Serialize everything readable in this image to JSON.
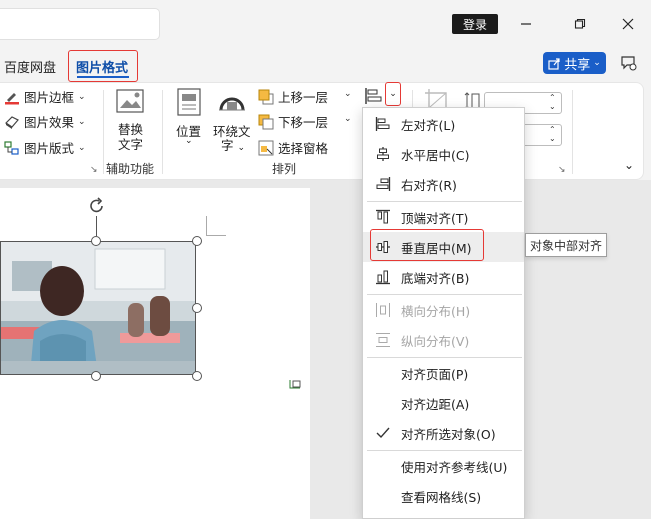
{
  "titlebar": {
    "login_label": "登录",
    "min_icon": "minimize-icon",
    "restore_icon": "restore-icon",
    "close_icon": "close-icon"
  },
  "tabs": [
    {
      "label": "百度网盘"
    },
    {
      "label": "图片格式",
      "active": true
    }
  ],
  "share": {
    "label": "共享"
  },
  "ribbon": {
    "picture_styles": [
      {
        "label": "图片边框",
        "icon": "picture-border-icon"
      },
      {
        "label": "图片效果",
        "icon": "picture-effects-icon"
      },
      {
        "label": "图片版式",
        "icon": "picture-layout-icon"
      }
    ],
    "accessibility": {
      "button_label_1": "替换",
      "button_label_2": "文字",
      "group_label": "辅助功能"
    },
    "arrange": {
      "position_label": "位置",
      "wrap_label_1": "环绕文",
      "wrap_label_2": "字",
      "bring_forward_label": "上移一层",
      "send_backward_label": "下移一层",
      "selection_pane_label": "选择窗格",
      "group_label": "排列"
    }
  },
  "align_menu": {
    "items": [
      {
        "label": "左对齐(L)",
        "icon": "align-left-icon",
        "disabled": false
      },
      {
        "label": "水平居中(C)",
        "icon": "align-center-icon",
        "disabled": false
      },
      {
        "label": "右对齐(R)",
        "icon": "align-right-icon",
        "disabled": false
      },
      {
        "label": "顶端对齐(T)",
        "icon": "align-top-icon",
        "disabled": false
      },
      {
        "label": "垂直居中(M)",
        "icon": "align-middle-icon",
        "disabled": false,
        "highlighted": true
      },
      {
        "label": "底端对齐(B)",
        "icon": "align-bottom-icon",
        "disabled": false
      },
      {
        "label": "横向分布(H)",
        "icon": "distribute-horizontal-icon",
        "disabled": true
      },
      {
        "label": "纵向分布(V)",
        "icon": "distribute-vertical-icon",
        "disabled": true
      },
      {
        "label": "对齐页面(P)",
        "disabled": false
      },
      {
        "label": "对齐边距(A)",
        "disabled": false
      },
      {
        "label": "对齐所选对象(O)",
        "checked": true,
        "disabled": false
      },
      {
        "label": "使用对齐参考线(U)",
        "disabled": false
      },
      {
        "label": "查看网格线(S)",
        "disabled": false
      }
    ],
    "tooltip": "对象中部对齐"
  },
  "colors": {
    "accent": "#1a5ec8",
    "highlight_box": "#e53935"
  }
}
